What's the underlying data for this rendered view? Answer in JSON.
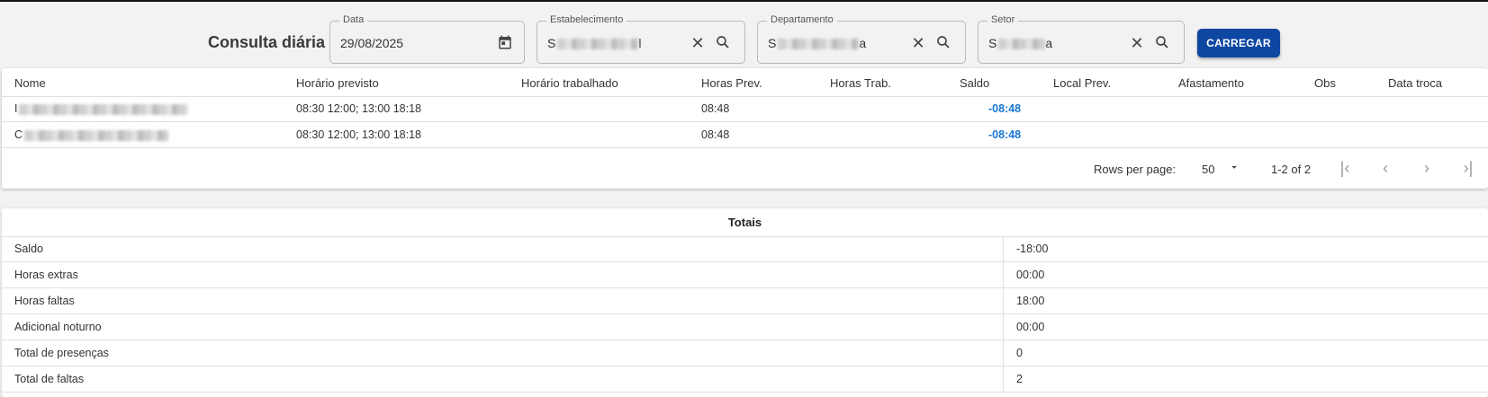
{
  "header": {
    "title": "Consulta diária",
    "load_label": "CARREGAR"
  },
  "filters": {
    "data": {
      "label": "Data",
      "value": "29/08/2025"
    },
    "estabelecimento": {
      "label": "Estabelecimento",
      "prefix": "S",
      "suffix": "l"
    },
    "departamento": {
      "label": "Departamento",
      "prefix": "S",
      "suffix": "a"
    },
    "setor": {
      "label": "Setor",
      "prefix": "S",
      "suffix": "a"
    }
  },
  "table": {
    "columns": [
      "Nome",
      "Horário previsto",
      "Horário trabalhado",
      "Horas Prev.",
      "Horas Trab.",
      "Saldo",
      "Local Prev.",
      "Afastamento",
      "Obs",
      "Data troca"
    ],
    "rows": [
      {
        "nome_prefix": "I",
        "horario_previsto": "08:30 12:00; 13:00 18:18",
        "horas_prev": "08:48",
        "saldo": "-08:48"
      },
      {
        "nome_prefix": "C",
        "horario_previsto": "08:30 12:00; 13:00 18:18",
        "horas_prev": "08:48",
        "saldo": "-08:48"
      }
    ],
    "pagination": {
      "rows_per_page_label": "Rows per page:",
      "rows_per_page": "50",
      "range": "1-2 of 2"
    }
  },
  "totals": {
    "title": "Totais",
    "rows": [
      {
        "label": "Saldo",
        "value": "-18:00"
      },
      {
        "label": "Horas extras",
        "value": "00:00"
      },
      {
        "label": "Horas faltas",
        "value": "18:00"
      },
      {
        "label": "Adicional noturno",
        "value": "00:00"
      },
      {
        "label": "Total de presenças",
        "value": "0"
      },
      {
        "label": "Total de faltas",
        "value": "2"
      }
    ]
  },
  "colors": {
    "accent": "#0d47a1",
    "negative": "#1976d2"
  }
}
